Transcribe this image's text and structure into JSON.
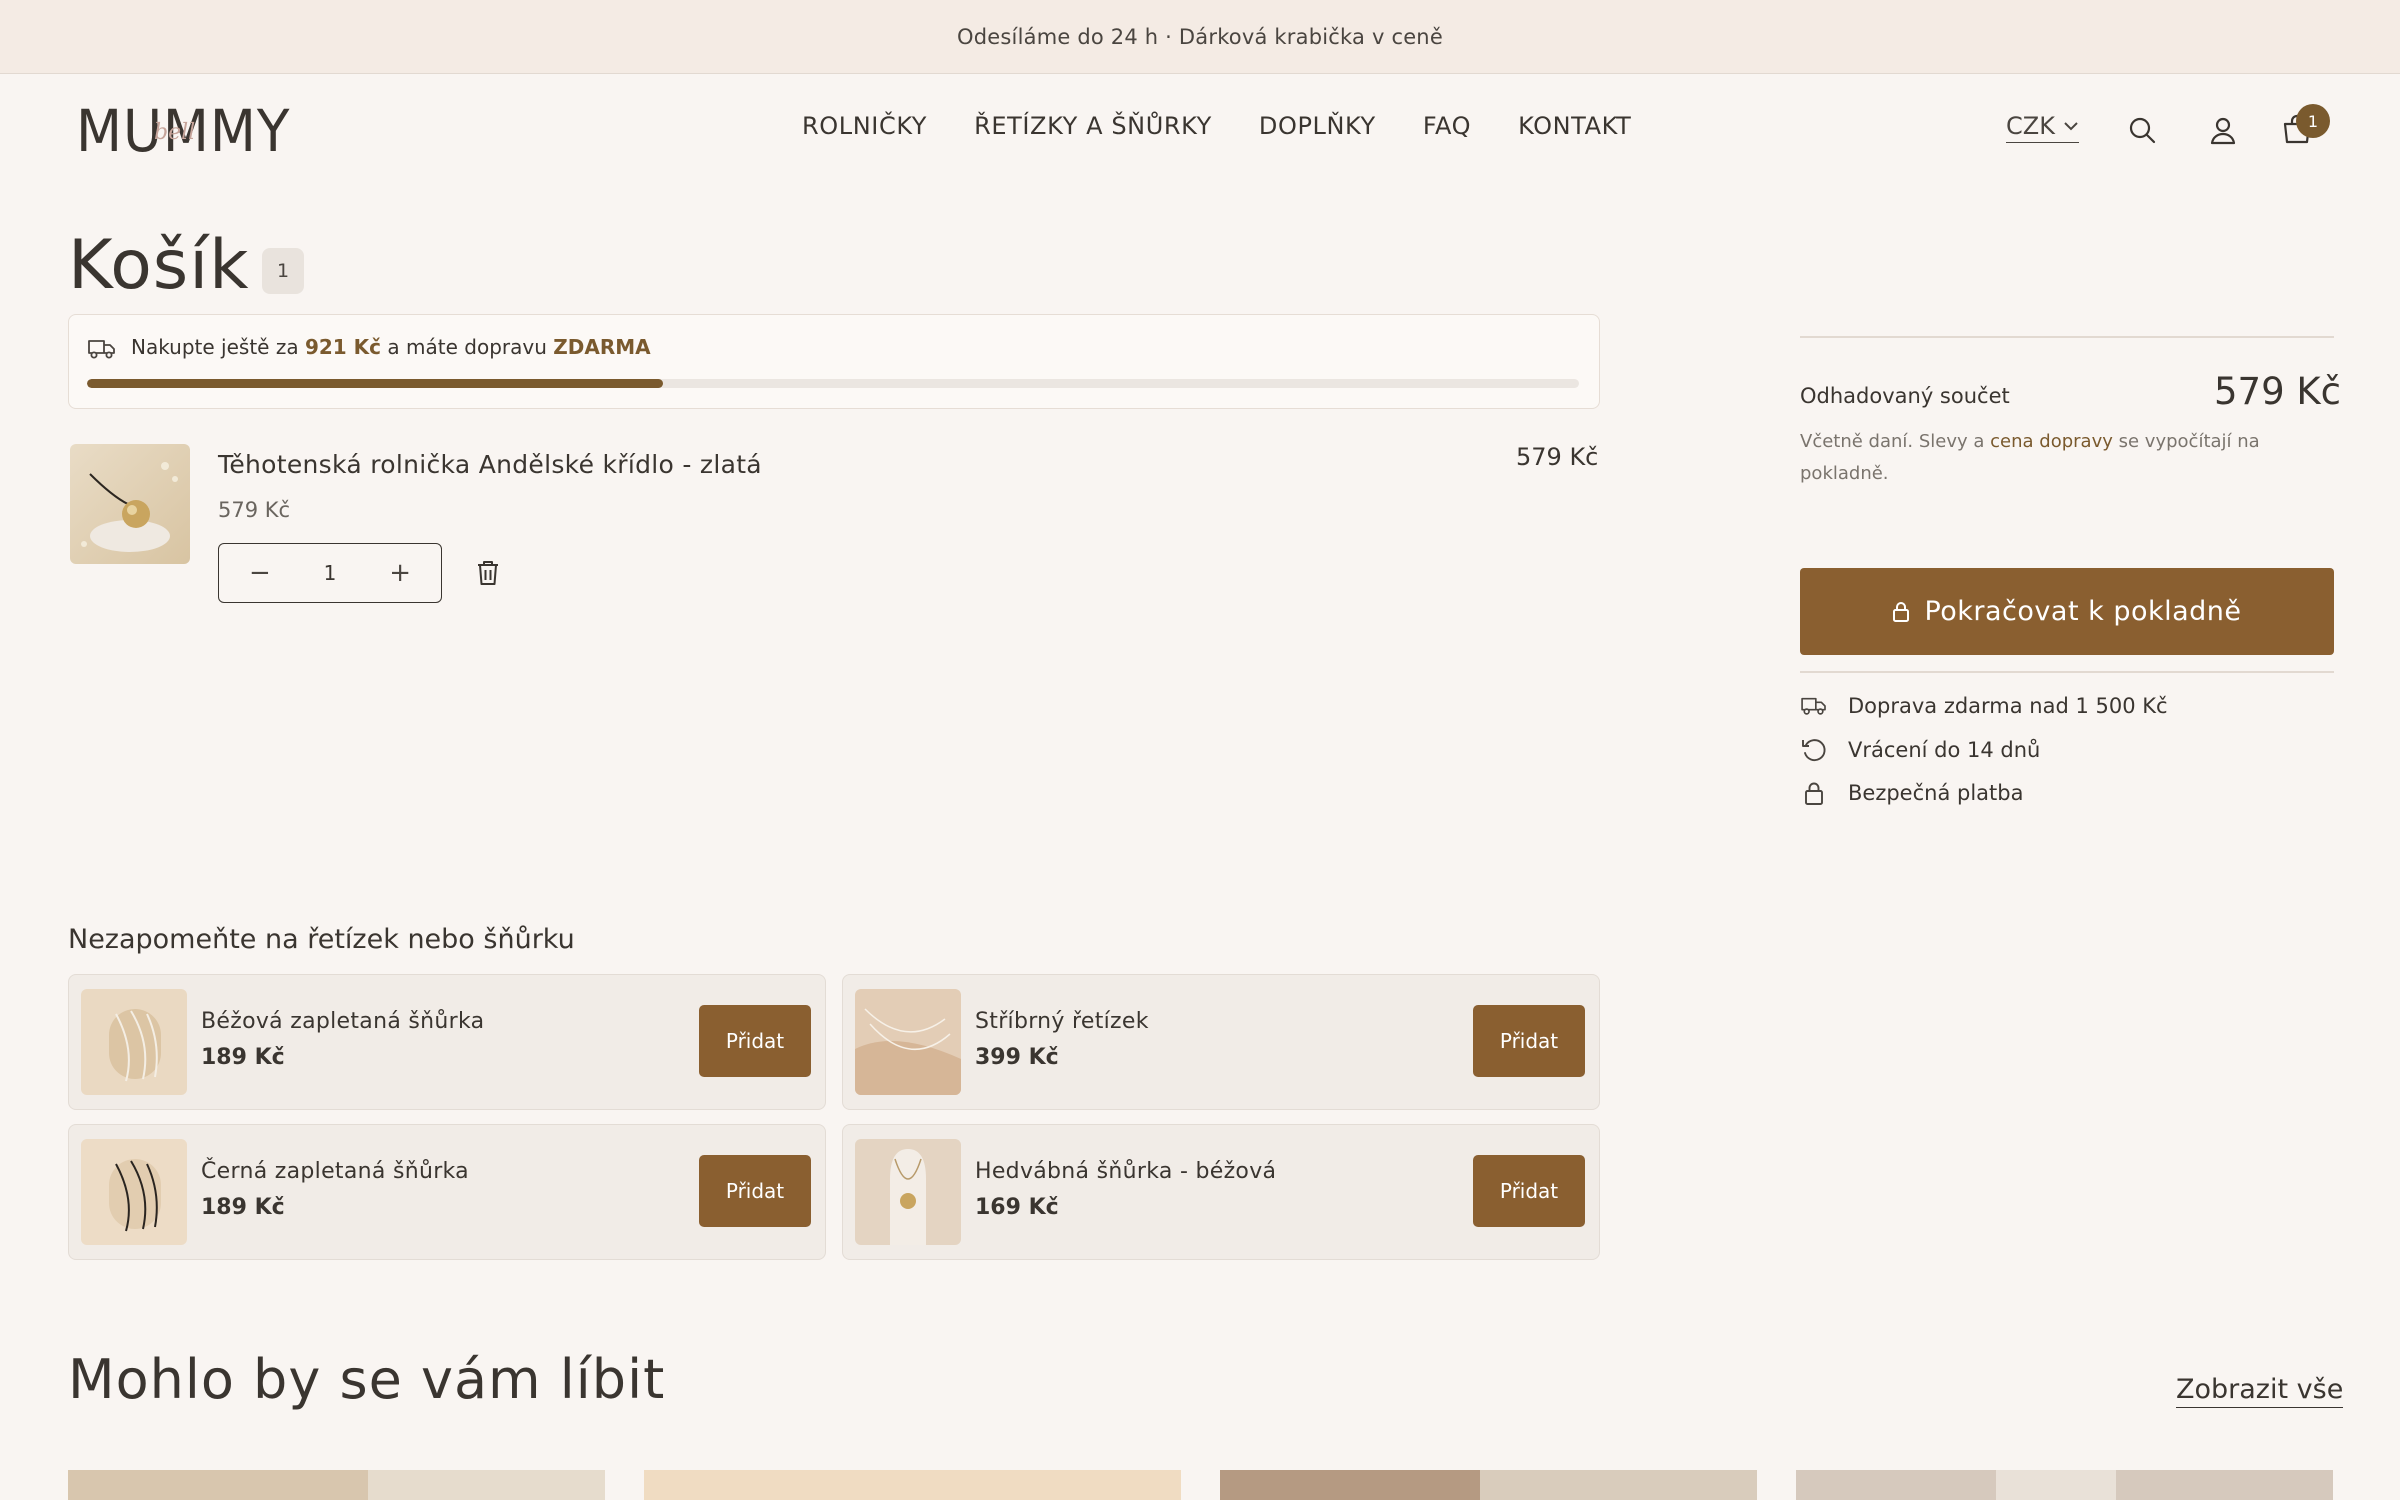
{
  "announcement": "Odesíláme do 24 h · Dárková krabička v ceně",
  "logo": {
    "word": "MUMMY",
    "script": "bell"
  },
  "nav": [
    "ROLNIČKY",
    "ŘETÍZKY A ŠŇŮRKY",
    "DOPLŇKY",
    "FAQ",
    "KONTAKT"
  ],
  "header": {
    "currency": "CZK",
    "cart_count": "1"
  },
  "cart": {
    "title": "Košík",
    "count": "1",
    "shipping": {
      "prefix": "Nakupte ještě za",
      "amount": "921 Kč",
      "middle": "a máte dopravu",
      "free": "ZDARMA",
      "progress_percent": 38.6
    },
    "item": {
      "name": "Těhotenská rolnička Andělské křídlo - zlatá",
      "unit_price": "579 Kč",
      "total": "579 Kč",
      "quantity": "1"
    }
  },
  "summary": {
    "label": "Odhadovaný součet",
    "value": "579 Kč",
    "note_before": "Včetně daní. Slevy a",
    "note_link": "cena dopravy",
    "note_after": "se vypočítají na pokladně.",
    "checkout": "Pokračovat k pokladně",
    "perks": [
      "Doprava zdarma nad 1 500 Kč",
      "Vrácení do 14 dnů",
      "Bezpečná platba"
    ]
  },
  "upsell": {
    "title": "Nezapomeňte na řetízek nebo šňůrku",
    "button": "Přidat",
    "items": [
      {
        "name": "Béžová zapletaná šňůrka",
        "price": "189 Kč"
      },
      {
        "name": "Stříbrný řetízek",
        "price": "399 Kč"
      },
      {
        "name": "Černá zapletaná šňůrka",
        "price": "189 Kč"
      },
      {
        "name": "Hedvábná šňůrka - béžová",
        "price": "169 Kč"
      }
    ]
  },
  "recommendations": {
    "title": "Mohlo by se vám líbit",
    "link": "Zobrazit vše"
  },
  "colors": {
    "accent": "#8a5f30",
    "background": "#f9f5f2",
    "text": "#3a3530"
  },
  "icons": [
    "search-icon",
    "account-icon",
    "cart-icon",
    "truck-icon",
    "return-icon",
    "lock-icon",
    "trash-icon"
  ]
}
